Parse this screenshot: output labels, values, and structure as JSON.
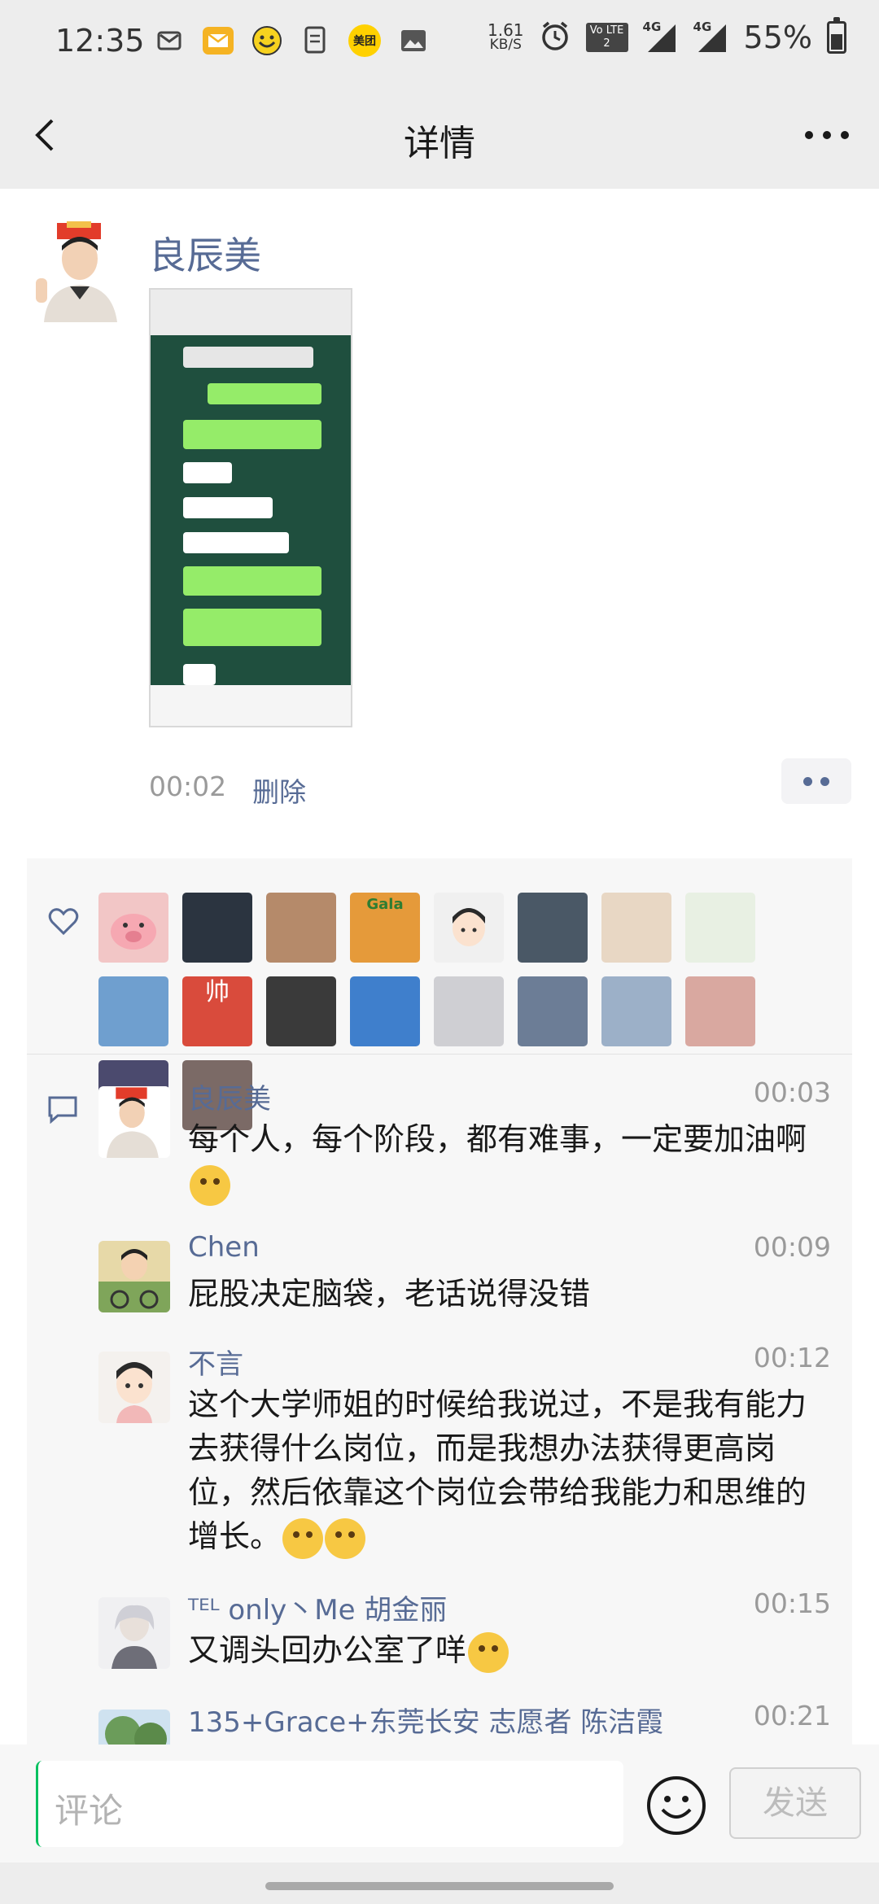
{
  "status_bar": {
    "time": "12:35",
    "net_speed_value": "1.61",
    "net_speed_unit": "KB/S",
    "volte": "Vo LTE 2",
    "network_1": "4G",
    "network_2": "4G",
    "battery": "55%",
    "battery_level": 0.55,
    "app_icons": [
      "mail-icon",
      "email-icon",
      "emoji-app-icon",
      "document-icon",
      "meituan-icon",
      "gallery-icon"
    ],
    "meituan_label": "美团"
  },
  "nav": {
    "title": "详情"
  },
  "post": {
    "author": "良辰美",
    "time": "00:02",
    "delete_label": "删除"
  },
  "likes": {
    "count": 18,
    "avatars": [
      "#f2c6c6",
      "#2b3440",
      "#b58a6a",
      "#e59a3a",
      "#f0f0f0",
      "#4a5866",
      "#e8d7c4",
      "#e8f0e3",
      "#6f9fcf",
      "#d94b3c",
      "#3a3a3a",
      "#3f7fcc",
      "#cfcfd3",
      "#6c7d96",
      "#9cb0c8",
      "#d9a8a0",
      "#4b4a6e",
      "#7b6a66"
    ],
    "shuai_text": "帅",
    "gala_text": "Gala"
  },
  "comments": [
    {
      "name": "良辰美",
      "time": "00:03",
      "text": "每个人，每个阶段，都有难事，一定要加油啊",
      "emoji_count": 1,
      "avatar_color": "#e9e4df"
    },
    {
      "name": "Chen",
      "time": "00:09",
      "text": "屁股决定脑袋，老话说得没错",
      "emoji_count": 0,
      "avatar_color": "#7fa55a"
    },
    {
      "name": "不言",
      "time": "00:12",
      "text": "这个大学师姐的时候给我说过，不是我有能力去获得什么岗位，而是我想办法获得更高岗位，然后依靠这个岗位会带给我能力和思维的增长。",
      "emoji_count": 2,
      "avatar_color": "#f4f1ee"
    },
    {
      "name": "ᵀᴱᴸ only丶Me 胡金丽",
      "time": "00:15",
      "text": "又调头回办公室了咩",
      "emoji_count": 1,
      "avatar_color": "#cdcdd2"
    },
    {
      "name": "135+Grace+东莞长安 志愿者 陈洁霞",
      "time": "00:21",
      "text": "",
      "emoji_count": 0,
      "avatar_color": "#6b9c5a"
    }
  ],
  "comment_bar": {
    "placeholder": "评论",
    "send_label": "发送"
  }
}
